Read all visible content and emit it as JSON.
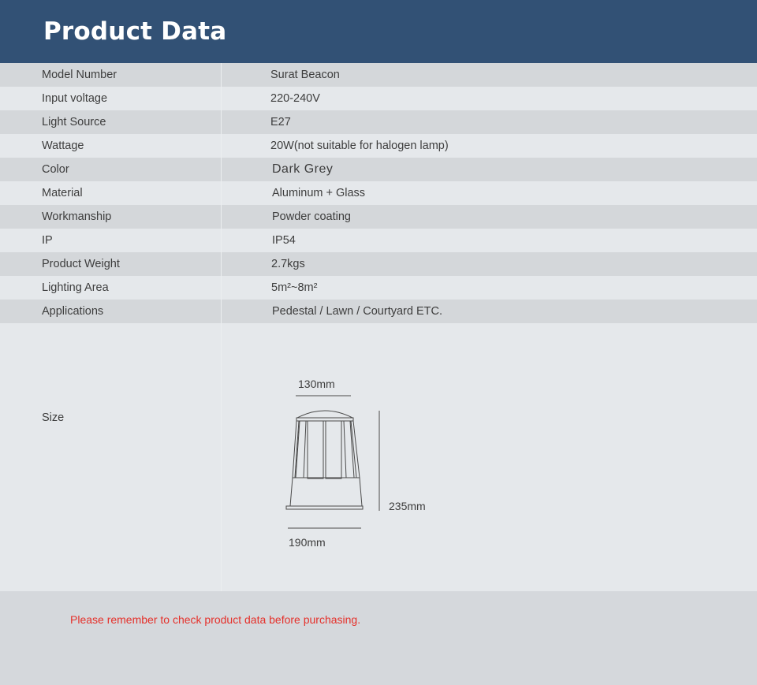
{
  "header": {
    "title": "Product Data"
  },
  "specs": [
    {
      "label": "Model Number",
      "value": "Surat Beacon"
    },
    {
      "label": "Input voltage",
      "value": "220-240V"
    },
    {
      "label": "Light Source",
      "value": "E27"
    },
    {
      "label": "Wattage",
      "value": "20W(not suitable for halogen lamp)"
    },
    {
      "label": "Color",
      "value": "Dark Grey"
    },
    {
      "label": "Material",
      "value": "Aluminum + Glass"
    },
    {
      "label": "Workmanship",
      "value": "Powder coating"
    },
    {
      "label": "IP",
      "value": "IP54"
    },
    {
      "label": "Product Weight",
      "value": "2.7kgs"
    },
    {
      "label": "Lighting Area",
      "value": "5m²~8m²"
    },
    {
      "label": "Applications",
      "value": "Pedestal / Lawn / Courtyard ETC."
    }
  ],
  "size": {
    "label": "Size",
    "top_width": "130mm",
    "height": "235mm",
    "base_width": "190mm"
  },
  "footer": {
    "note": "Please remember to check product data before purchasing.",
    "note_color": "#e5302a"
  },
  "colors": {
    "header_bg": "#325175",
    "row_dark": "#d4d7da",
    "row_light": "#e5e8eb"
  }
}
